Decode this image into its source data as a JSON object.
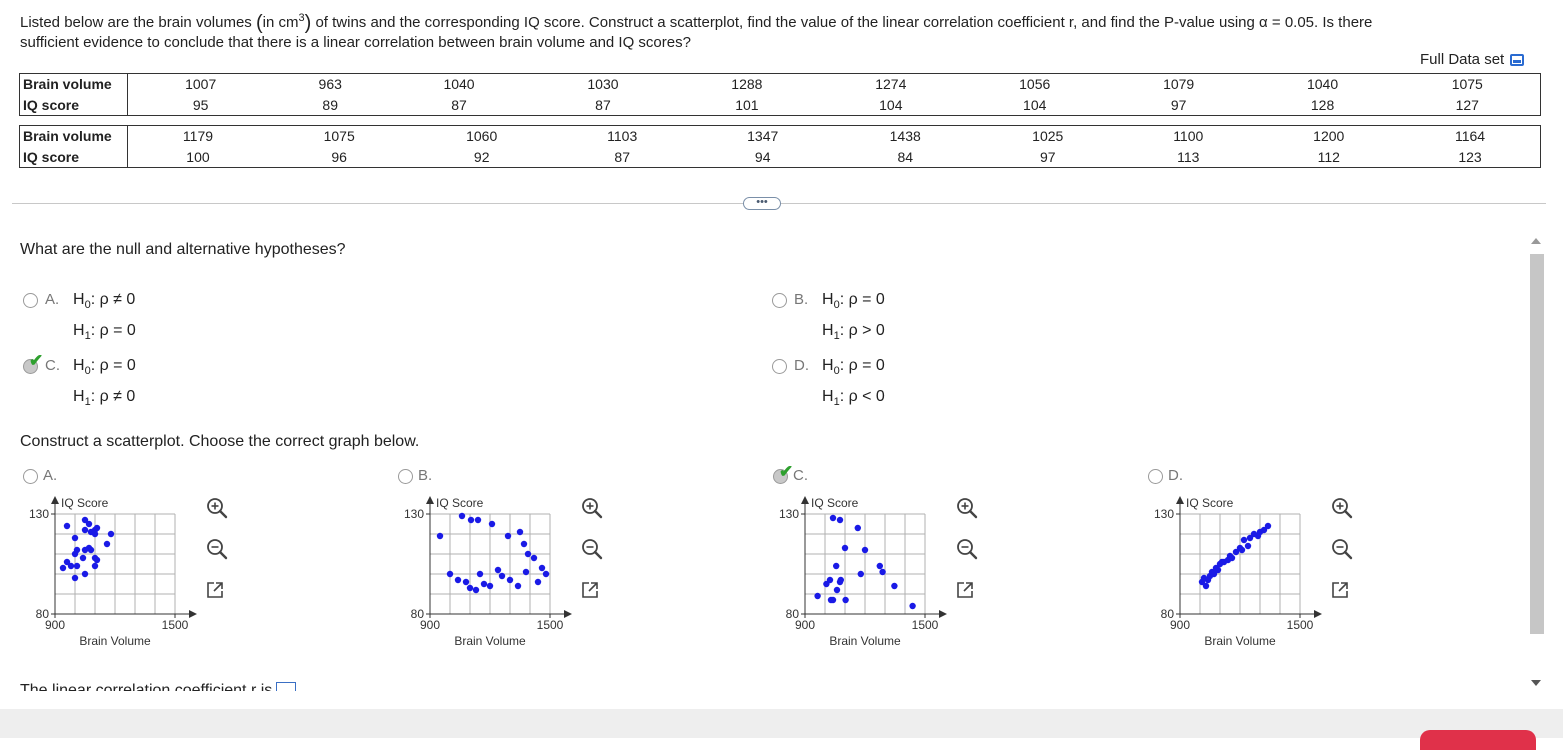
{
  "question": {
    "text1": "Listed below are the brain volumes ",
    "unit": "in cm",
    "unit_exp": "3",
    "text2": " of twins and the corresponding IQ score. Construct a scatterplot, find the value of the linear correlation coefficient r, and find the P-value using ",
    "alpha": "α = 0.05",
    "text3": ". Is there",
    "text4": "sufficient evidence to conclude that there is a linear correlation between brain volume and IQ scores?"
  },
  "full_data_set": "Full Data set",
  "table": {
    "row_labels": [
      "Brain volume",
      "IQ score"
    ],
    "block1": {
      "brain": [
        "1007",
        "963",
        "1040",
        "1030",
        "1288",
        "1274",
        "1056",
        "1079",
        "1040",
        "1075"
      ],
      "iq": [
        "95",
        "89",
        "87",
        "87",
        "101",
        "104",
        "104",
        "97",
        "128",
        "127"
      ]
    },
    "block2": {
      "brain": [
        "1179",
        "1075",
        "1060",
        "1103",
        "1347",
        "1438",
        "1025",
        "1100",
        "1200",
        "1164"
      ],
      "iq": [
        "100",
        "96",
        "92",
        "87",
        "94",
        "84",
        "97",
        "113",
        "112",
        "123"
      ]
    }
  },
  "more_button": "•••",
  "hypotheses": {
    "prompt": "What are the null and alternative hypotheses?",
    "options": [
      {
        "letter": "A.",
        "h0_lhs": "H",
        "h0_sub": "0",
        "h0": ": ρ ≠ 0",
        "h1_lhs": "H",
        "h1_sub": "1",
        "h1": ": ρ = 0",
        "selected": false
      },
      {
        "letter": "B.",
        "h0_lhs": "H",
        "h0_sub": "0",
        "h0": ": ρ = 0",
        "h1_lhs": "H",
        "h1_sub": "1",
        "h1": ": ρ > 0",
        "selected": false
      },
      {
        "letter": "C.",
        "h0_lhs": "H",
        "h0_sub": "0",
        "h0": ": ρ = 0",
        "h1_lhs": "H",
        "h1_sub": "1",
        "h1": ": ρ ≠ 0",
        "selected": true
      },
      {
        "letter": "D.",
        "h0_lhs": "H",
        "h0_sub": "0",
        "h0": ": ρ = 0",
        "h1_lhs": "H",
        "h1_sub": "1",
        "h1": ": ρ < 0",
        "selected": false
      }
    ]
  },
  "scatter": {
    "prompt": "Construct a scatterplot. Choose the correct graph below.",
    "y_title": "IQ Score",
    "x_title": "Brain Volume",
    "y_top": "130",
    "y_bottom": "80",
    "x_left": "900",
    "x_right": "1500",
    "options": [
      {
        "letter": "A.",
        "selected": false,
        "points": [
          [
            960,
            124
          ],
          [
            1050,
            127
          ],
          [
            1050,
            122
          ],
          [
            1070,
            125
          ],
          [
            1080,
            121
          ],
          [
            1100,
            120
          ],
          [
            1110,
            123
          ],
          [
            1050,
            100
          ],
          [
            1100,
            104
          ],
          [
            1110,
            107
          ],
          [
            1000,
            110
          ],
          [
            1070,
            113
          ],
          [
            1000,
            98
          ],
          [
            940,
            103
          ],
          [
            960,
            106
          ],
          [
            980,
            104
          ],
          [
            1010,
            104
          ],
          [
            1000,
            118
          ],
          [
            1160,
            115
          ],
          [
            1180,
            120
          ],
          [
            1100,
            108
          ],
          [
            1080,
            112
          ],
          [
            1100,
            122
          ],
          [
            1050,
            112
          ],
          [
            1010,
            112
          ],
          [
            1040,
            108
          ]
        ]
      },
      {
        "letter": "B.",
        "selected": false,
        "points": [
          [
            950,
            119
          ],
          [
            1060,
            129
          ],
          [
            1105,
            127
          ],
          [
            1140,
            127
          ],
          [
            1210,
            125
          ],
          [
            1290,
            119
          ],
          [
            1350,
            121
          ],
          [
            1370,
            115
          ],
          [
            1390,
            110
          ],
          [
            1420,
            108
          ],
          [
            1000,
            100
          ],
          [
            1040,
            97
          ],
          [
            1080,
            96
          ],
          [
            1100,
            93
          ],
          [
            1130,
            92
          ],
          [
            1150,
            100
          ],
          [
            1170,
            95
          ],
          [
            1200,
            94
          ],
          [
            1240,
            102
          ],
          [
            1260,
            99
          ],
          [
            1300,
            97
          ],
          [
            1340,
            94
          ],
          [
            1380,
            101
          ],
          [
            1440,
            96
          ],
          [
            1460,
            103
          ],
          [
            1480,
            100
          ]
        ]
      },
      {
        "letter": "C.",
        "selected": true,
        "points": [
          [
            1007,
            95
          ],
          [
            963,
            89
          ],
          [
            1040,
            87
          ],
          [
            1030,
            87
          ],
          [
            1288,
            101
          ],
          [
            1274,
            104
          ],
          [
            1056,
            104
          ],
          [
            1079,
            97
          ],
          [
            1040,
            128
          ],
          [
            1075,
            127
          ],
          [
            1179,
            100
          ],
          [
            1075,
            96
          ],
          [
            1060,
            92
          ],
          [
            1103,
            87
          ],
          [
            1347,
            94
          ],
          [
            1438,
            84
          ],
          [
            1025,
            97
          ],
          [
            1100,
            113
          ],
          [
            1200,
            112
          ],
          [
            1164,
            123
          ]
        ]
      },
      {
        "letter": "D.",
        "selected": false,
        "points": [
          [
            1010,
            96
          ],
          [
            1020,
            98
          ],
          [
            1040,
            97
          ],
          [
            1050,
            99
          ],
          [
            1060,
            101
          ],
          [
            1070,
            100
          ],
          [
            1080,
            103
          ],
          [
            1090,
            102
          ],
          [
            1100,
            105
          ],
          [
            1110,
            106
          ],
          [
            1120,
            106
          ],
          [
            1140,
            107
          ],
          [
            1150,
            109
          ],
          [
            1160,
            108
          ],
          [
            1180,
            111
          ],
          [
            1200,
            113
          ],
          [
            1210,
            112
          ],
          [
            1220,
            117
          ],
          [
            1240,
            114
          ],
          [
            1250,
            118
          ],
          [
            1270,
            120
          ],
          [
            1290,
            119
          ],
          [
            1300,
            121
          ],
          [
            1320,
            122
          ],
          [
            1340,
            124
          ],
          [
            1030,
            94
          ]
        ]
      }
    ]
  },
  "correlation_prompt": "The linear correlation coefficient r is"
}
